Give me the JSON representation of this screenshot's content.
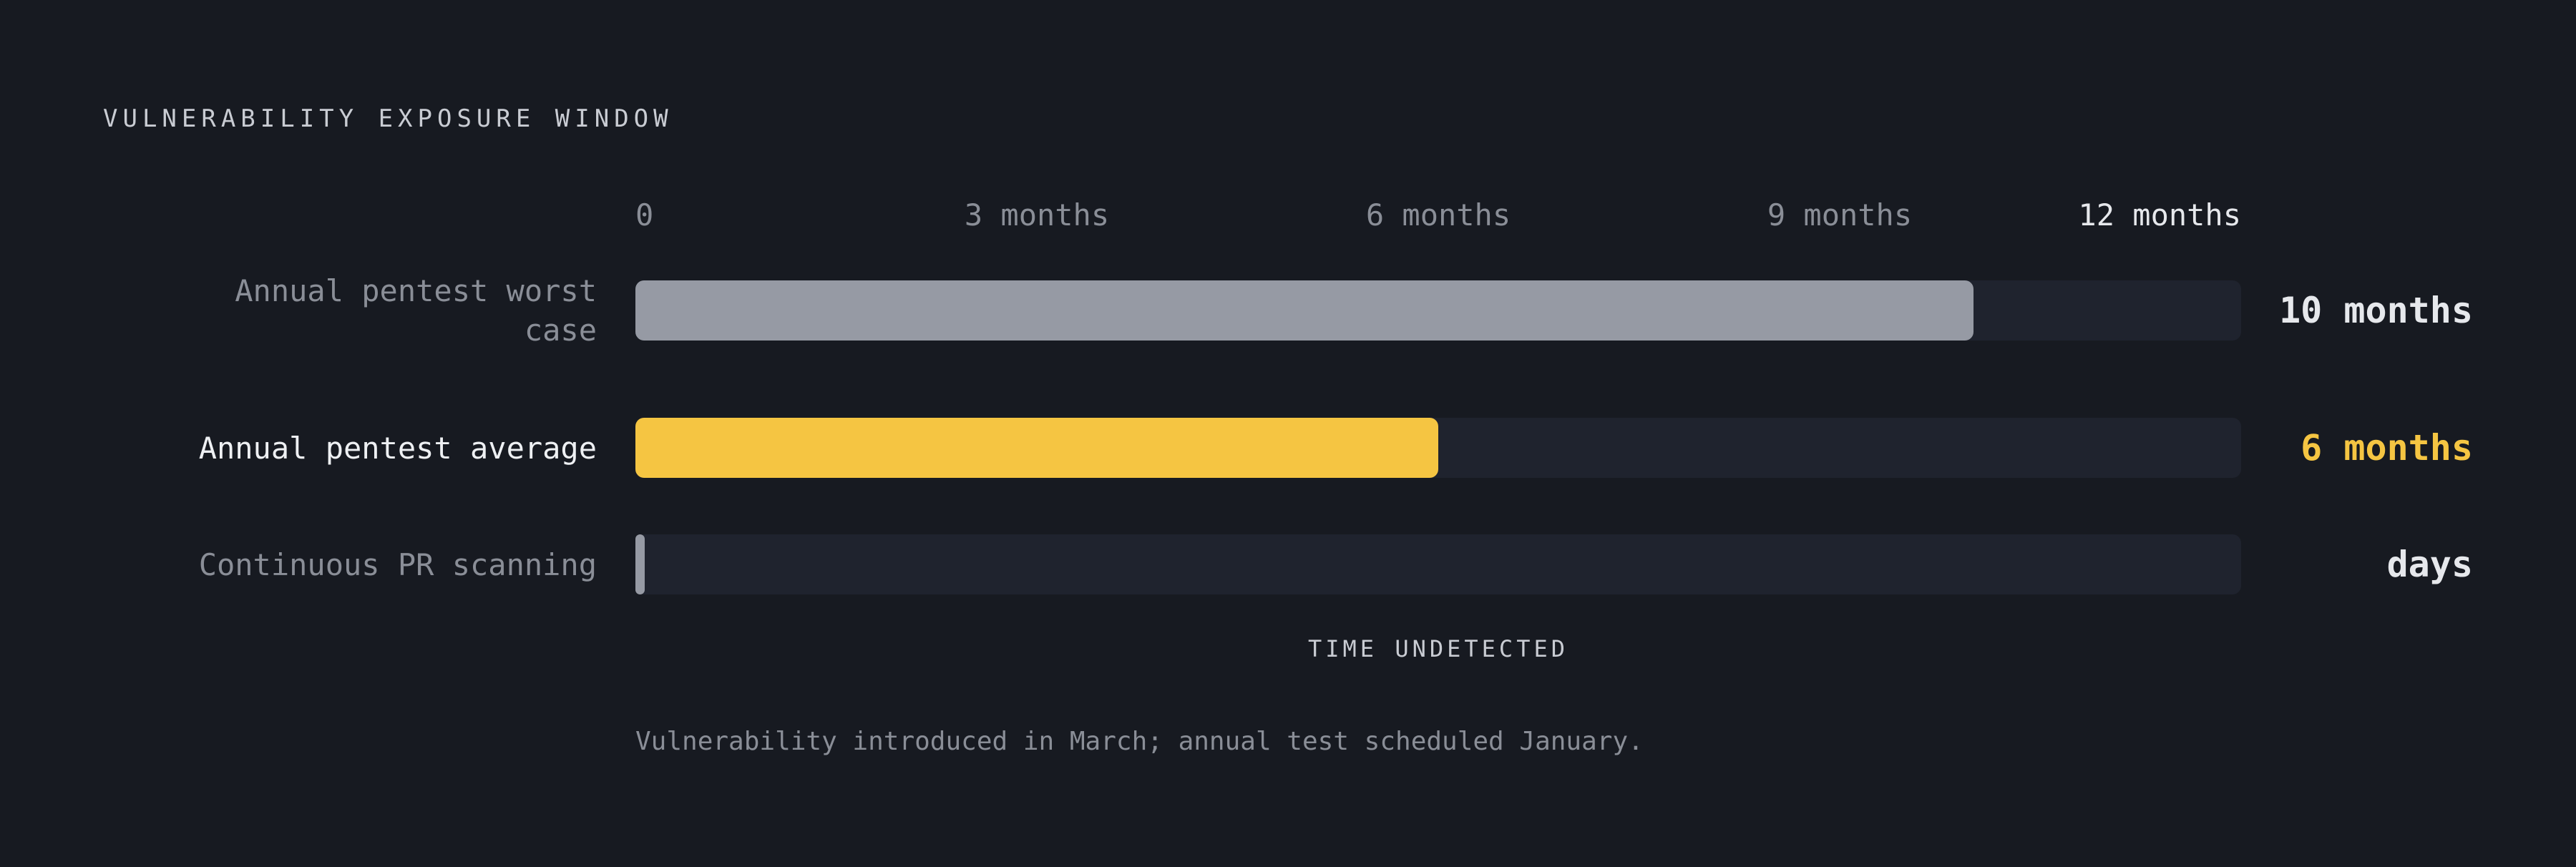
{
  "chart_data": {
    "type": "bar",
    "orientation": "horizontal",
    "title": "VULNERABILITY EXPOSURE WINDOW",
    "xlabel": "TIME UNDETECTED",
    "xlim": [
      0,
      12
    ],
    "x_unit": "months",
    "ticks": [
      {
        "value": 0,
        "label": "0"
      },
      {
        "value": 3,
        "label": "3 months"
      },
      {
        "value": 6,
        "label": "6 months"
      },
      {
        "value": 9,
        "label": "9 months"
      },
      {
        "value": 12,
        "label": "12 months"
      }
    ],
    "categories": [
      "Annual pentest worst case",
      "Annual pentest average",
      "Continuous PR scanning"
    ],
    "values": [
      10,
      6,
      0.07
    ],
    "value_labels": [
      "10 months",
      "6 months",
      "days"
    ],
    "bar_colors": [
      "#969aa4",
      "#f5c542",
      "#969aa4"
    ],
    "value_label_colors": [
      "#e6e8ec",
      "#f5c542",
      "#e6e8ec"
    ],
    "highlighted_category": "Annual pentest average",
    "grid": false,
    "legend": "none",
    "note": "Vulnerability introduced in March; annual test scheduled January."
  },
  "colors": {
    "background": "#171a21",
    "track": "#1f232e",
    "accent": "#f5c542",
    "muted_text": "#8a8e97",
    "bright_text": "#e6e8ec"
  }
}
